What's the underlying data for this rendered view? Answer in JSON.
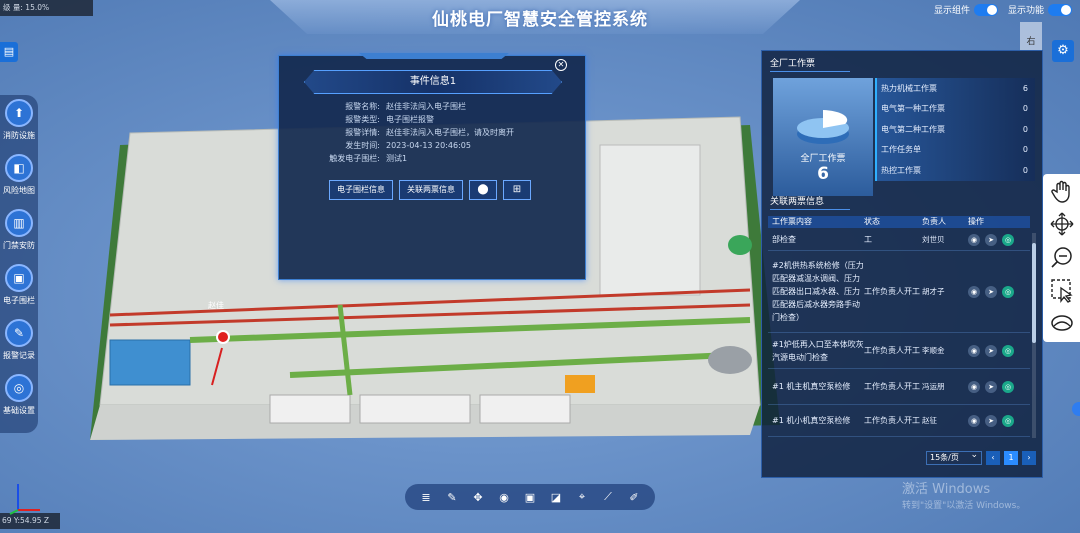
{
  "title": "仙桃电厂智慧安全管控系统",
  "coords": {
    "top": "级 量: 15.0%",
    "bottom": "69 Y:54.95 Z"
  },
  "toggles": [
    {
      "label": "显示组件"
    },
    {
      "label": "显示功能"
    }
  ],
  "corner_button": "右",
  "sidebar": [
    {
      "label": "消防设施",
      "icon": "fire-hydrant-icon"
    },
    {
      "label": "风险地图",
      "icon": "map-icon"
    },
    {
      "label": "门禁安防",
      "icon": "door-icon"
    },
    {
      "label": "电子围栏",
      "icon": "fence-icon"
    },
    {
      "label": "报警记录",
      "icon": "alarm-record-icon"
    },
    {
      "label": "基础设置",
      "icon": "settings-icon"
    }
  ],
  "scene": {
    "marker_label": "赵佳"
  },
  "event": {
    "title": "事件信息1",
    "fields": [
      {
        "key": "报警名称:",
        "value": "赵佳非法闯入电子围栏"
      },
      {
        "key": "报警类型:",
        "value": "电子围栏报警"
      },
      {
        "key": "报警详情:",
        "value": "赵佳非法闯入电子围栏，请及时离开"
      },
      {
        "key": "发生时间:",
        "value": "2023-04-13 20:46:05"
      },
      {
        "key": "触发电子围栏:",
        "value": "测试1"
      }
    ],
    "buttons": [
      "电子围栏信息",
      "关联两票信息"
    ]
  },
  "panel": {
    "work_title": "全厂工作票",
    "total_label": "全厂工作票",
    "total": "6",
    "categories": [
      {
        "label": "热力机械工作票",
        "count": "6"
      },
      {
        "label": "电气第一种工作票",
        "count": "0"
      },
      {
        "label": "电气第二种工作票",
        "count": "0"
      },
      {
        "label": "工作任务单",
        "count": "0"
      },
      {
        "label": "热控工作票",
        "count": "0"
      }
    ],
    "related_title": "关联两票信息",
    "columns": [
      "工作票内容",
      "状态",
      "负责人",
      "操作"
    ],
    "rows": [
      {
        "content": "部检查",
        "status": "工",
        "owner": "刘世贝"
      },
      {
        "content": "#2机供热系统检修（压力匹配器减温水调阀、压力匹配器出口减水器、压力匹配器后减水器旁路手动门检查）",
        "status": "工作负责人开工",
        "owner": "胡才子"
      },
      {
        "content": "#1炉低再入口至本体吹灰汽源电动门检查",
        "status": "工作负责人开工",
        "owner": "李顺金"
      },
      {
        "content": "#1 机主机真空泵检修",
        "status": "工作负责人开工",
        "owner": "冯运朋"
      },
      {
        "content": "#1 机小机真空泵检修",
        "status": "工作负责人开工",
        "owner": "赵征"
      }
    ],
    "page_size": "15条/页",
    "current_page": "1"
  },
  "watermark": {
    "line1": "激活 Windows",
    "line2": "转到\"设置\"以激活 Windows。"
  }
}
